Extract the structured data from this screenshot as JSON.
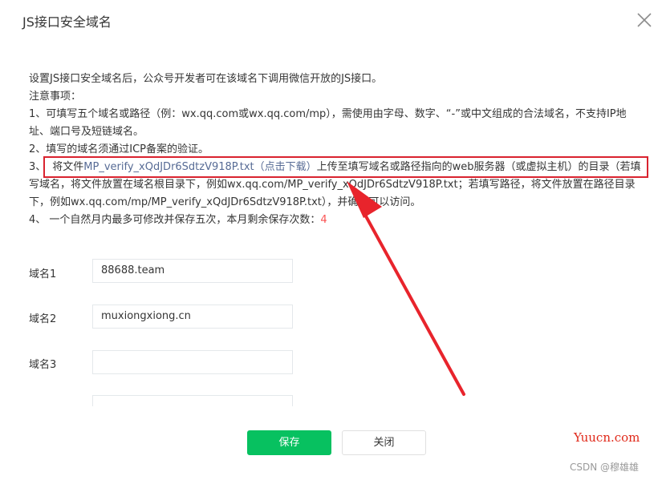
{
  "dialog": {
    "title": "JS接口安全域名",
    "close_icon": "close-icon"
  },
  "notes": {
    "intro": "设置JS接口安全域名后，公众号开发者可在该域名下调用微信开放的JS接口。",
    "heading": "注意事项：",
    "item1": "1、可填写五个域名或路径（例：wx.qq.com或wx.qq.com/mp），需使用由字母、数字、“-”或中文组成的合法域名，不支持IP地址、端口号及短链域名。",
    "item2": "2、填写的域名须通过ICP备案的验证。",
    "item3_prefix": "3、",
    "item3_text_a": "将文件",
    "item3_link": "MP_verify_xQdJDr6SdtzV918P.txt（点击下载）",
    "item3_text_b": "上传至填写域名或路径指向的web服务器（或虚拟主机）的目录",
    "item3_rest": "（若填写域名，将文件放置在域名根目录下，例如wx.qq.com/MP_verify_xQdJDr6SdtzV918P.txt；若填写路径，将文件放置在路径目录下，例如wx.qq.com/mp/MP_verify_xQdJDr6SdtzV918P.txt），并确保可以访问。",
    "item4_text": "4、 一个自然月内最多可修改并保存五次，本月剩余保存次数：",
    "item4_count": "4"
  },
  "fields": [
    {
      "label": "域名1",
      "value": "88688.team"
    },
    {
      "label": "域名2",
      "value": "muxiongxiong.cn"
    },
    {
      "label": "域名3",
      "value": ""
    }
  ],
  "buttons": {
    "save": "保存",
    "close": "关闭"
  },
  "watermarks": {
    "yuucn": "Yuucn.com",
    "csdn": "CSDN @穆雄雄"
  },
  "colors": {
    "primary": "#07c160",
    "link": "#576b95",
    "annotation": "#d9232f"
  }
}
